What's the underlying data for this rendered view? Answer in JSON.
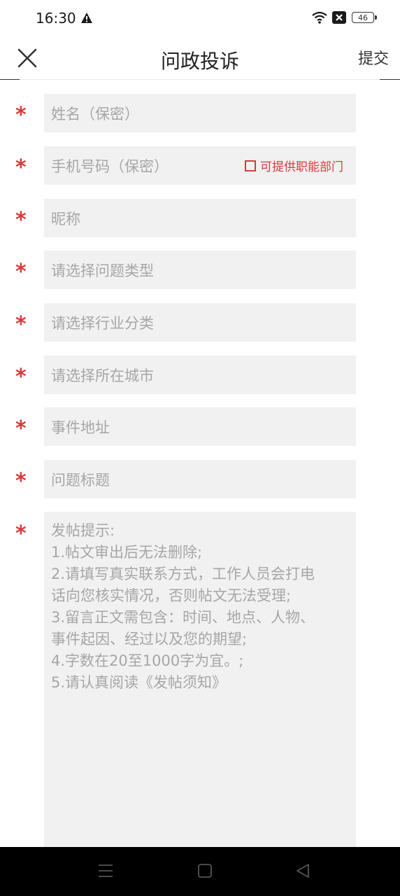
{
  "status_bar": {
    "time": "16:30",
    "battery": "46",
    "icons": [
      "warning-icon",
      "wifi-icon",
      "no-sim-icon",
      "battery-icon"
    ]
  },
  "header": {
    "title": "问政投诉",
    "submit_label": "提交",
    "close_icon": "close-icon"
  },
  "form": {
    "required_mark": "*",
    "fields": [
      {
        "placeholder": "姓名（保密）"
      },
      {
        "placeholder": "手机号码（保密）",
        "checkbox_label": "可提供职能部门"
      },
      {
        "placeholder": "昵称"
      },
      {
        "placeholder": "请选择问题类型"
      },
      {
        "placeholder": "请选择行业分类"
      },
      {
        "placeholder": "请选择所在城市"
      },
      {
        "placeholder": "事件地址"
      },
      {
        "placeholder": "问题标题"
      }
    ],
    "content_placeholder_lines": [
      "发帖提示:",
      "1.帖文审出后无法删除;",
      "2.请填写真实联系方式，工作人员会打电",
      "话向您核实情况，否则帖文无法受理;",
      "3.留言正文需包含：时间、地点、人物、",
      "事件起因、经过以及您的期望;",
      "4.字数在20至1000字为宜。;",
      "5.请认真阅读《发帖须知》"
    ]
  },
  "colors": {
    "accent_red": "#d93a3a",
    "field_bg": "#f1f1f1",
    "placeholder": "#a6a6a6"
  },
  "nav_bar": {
    "icons": [
      "menu-icon",
      "home-icon",
      "back-icon"
    ]
  }
}
